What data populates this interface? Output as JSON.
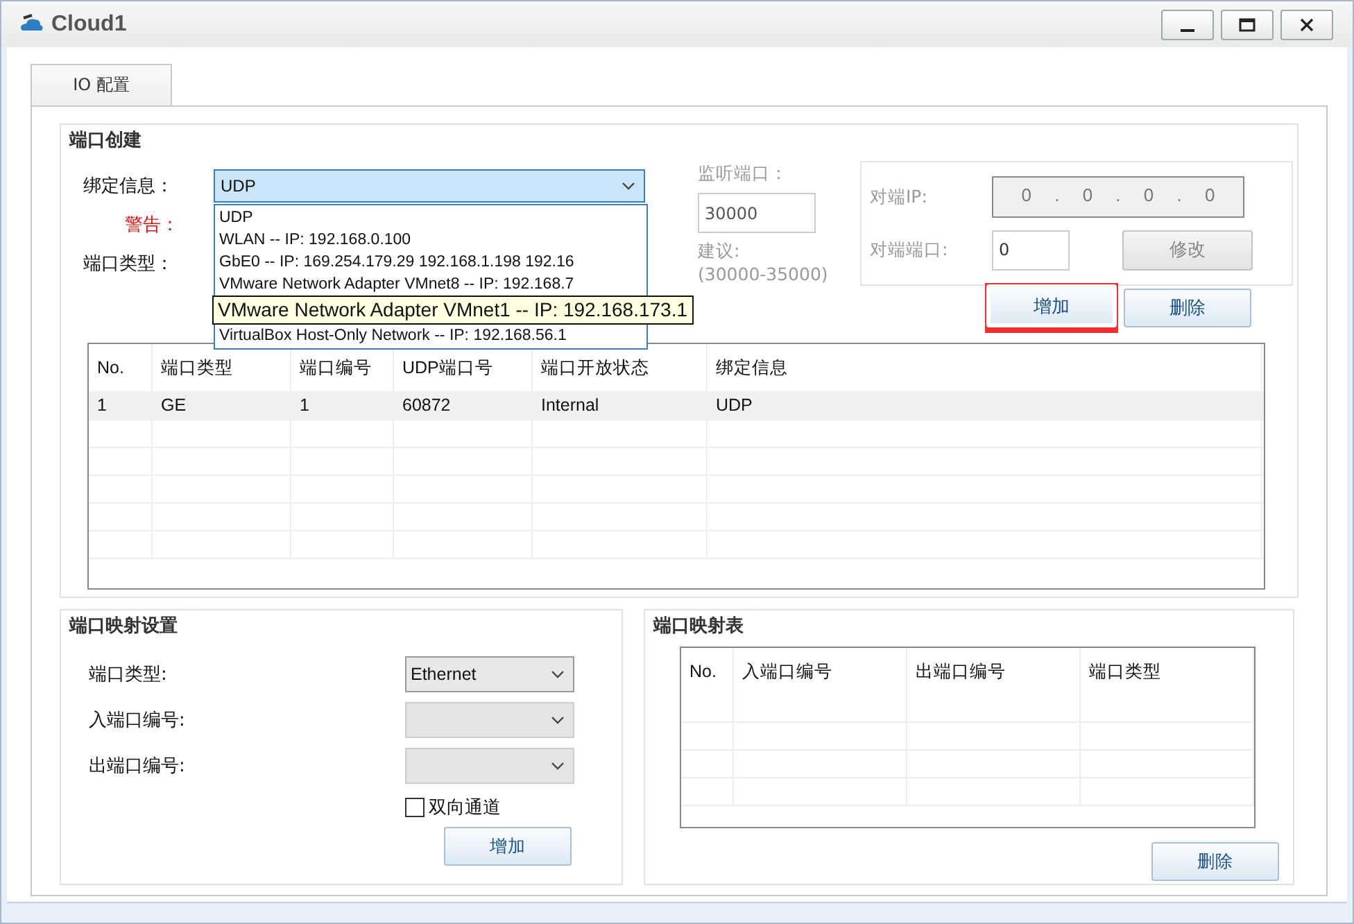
{
  "window": {
    "title": "Cloud1"
  },
  "tabs": [
    {
      "label": "IO 配置",
      "selected": true
    }
  ],
  "port_creation": {
    "title": "端口创建",
    "binding": {
      "label": "绑定信息：",
      "value": "UDP",
      "expanded": true,
      "options": [
        {
          "label": "UDP",
          "highlighted": false
        },
        {
          "label": "WLAN -- IP: 192.168.0.100",
          "highlighted": false
        },
        {
          "label": "GbE0 -- IP: 169.254.179.29 192.168.1.198 192.16",
          "highlighted": false
        },
        {
          "label": "VMware Network Adapter VMnet8 -- IP: 192.168.7",
          "highlighted": false
        },
        {
          "label": "VMware Network Adapter VMnet1 -- IP: 192.168.173.1",
          "highlighted": true
        },
        {
          "label": "VirtualBox Host-Only Network -- IP: 192.168.56.1",
          "highlighted": false
        }
      ]
    },
    "warning_label": "警告：",
    "port_type_label": "端口类型：",
    "listen_port": {
      "label": "监听端口：",
      "value": "30000",
      "hint": "建议:",
      "range": "(30000-35000)"
    },
    "peer": {
      "disabled": true,
      "ip_label": "对端IP:",
      "ip_octets": [
        "0",
        "0",
        "0",
        "0"
      ],
      "ip_separator": ".",
      "port_label": "对端端口:",
      "port_value": "0",
      "modify_button": "修改"
    },
    "buttons": [
      {
        "label": "增加",
        "highlighted": true
      },
      {
        "label": "删除",
        "highlighted": false
      }
    ],
    "table": {
      "columns": [
        "No.",
        "端口类型",
        "端口编号",
        "UDP端口号",
        "端口开放状态",
        "绑定信息"
      ],
      "rows": [
        [
          "1",
          "GE",
          "1",
          "60872",
          "Internal",
          "UDP"
        ]
      ]
    }
  },
  "mapping_settings": {
    "title": "端口映射设置",
    "fields": [
      {
        "label": "端口类型:",
        "value": "Ethernet",
        "disabled": false
      },
      {
        "label": "入端口编号:",
        "disabled": true
      },
      {
        "label": "出端口编号:",
        "disabled": true
      }
    ],
    "two_way": {
      "label": "双向通道",
      "checked": false
    },
    "add_button": "增加"
  },
  "mapping_table": {
    "title": "端口映射表",
    "columns": [
      "No.",
      "入端口编号",
      "出端口编号",
      "端口类型"
    ],
    "delete_button": "删除"
  }
}
